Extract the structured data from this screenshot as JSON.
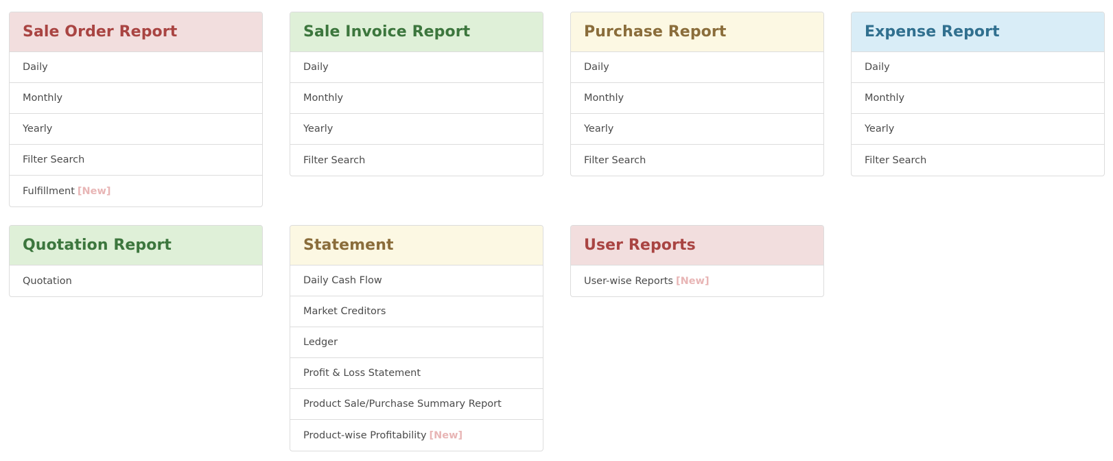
{
  "panels": {
    "sale_order": {
      "title": "Sale Order Report",
      "items": [
        "Daily",
        "Monthly",
        "Yearly",
        "Filter Search",
        "Fulfillment"
      ],
      "badge": "[New]"
    },
    "sale_invoice": {
      "title": "Sale Invoice Report",
      "items": [
        "Daily",
        "Monthly",
        "Yearly",
        "Filter Search"
      ]
    },
    "purchase": {
      "title": "Purchase Report",
      "items": [
        "Daily",
        "Monthly",
        "Yearly",
        "Filter Search"
      ]
    },
    "expense": {
      "title": "Expense Report",
      "items": [
        "Daily",
        "Monthly",
        "Yearly",
        "Filter Search"
      ]
    },
    "quotation": {
      "title": "Quotation Report",
      "items": [
        "Quotation"
      ]
    },
    "statement": {
      "title": "Statement",
      "items": [
        "Daily Cash Flow",
        "Market Creditors",
        "Ledger",
        "Profit & Loss Statement",
        "Product Sale/Purchase Summary Report",
        "Product-wise Profitability"
      ],
      "badge": "[New]"
    },
    "user_reports": {
      "title": "User Reports",
      "items": [
        "User-wise Reports"
      ],
      "badge": "[New]"
    }
  },
  "colors": {
    "red_bg": "#f2dede",
    "red_text": "#a94442",
    "green_bg": "#dff0d8",
    "green_text": "#3c763d",
    "yellow_bg": "#fcf8e3",
    "yellow_text": "#8a6d3b",
    "blue_bg": "#d9edf7",
    "blue_text": "#31708f",
    "badge_new": "#e8b5b5"
  }
}
